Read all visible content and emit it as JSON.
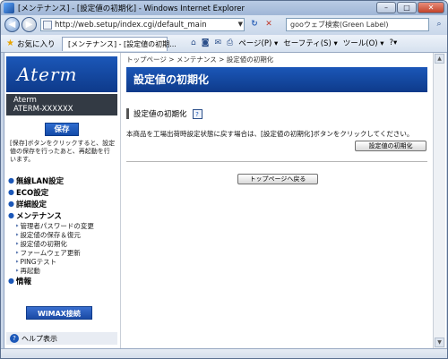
{
  "window": {
    "title": "[メンテナンス] - [設定値の初期化] - Windows Internet Explorer",
    "min": "–",
    "max": "□",
    "close": "✕"
  },
  "address": {
    "url": "http://web.setup/index.cgi/default_main",
    "search_text": "gooウェブ検索(Green Label)"
  },
  "favorites": {
    "label": "お気に入り",
    "tab_title": "[メンテナンス] - [設定値の初期...",
    "menus": [
      "ページ(P) ▾",
      "セーフティ(S) ▾",
      "ツール(O) ▾",
      "?▾"
    ]
  },
  "sidebar": {
    "logo_text": "Aterm",
    "model_line1": "Aterm",
    "model_line2": "ATERM-XXXXXX",
    "save_label": "保存",
    "save_note": "[保存]ボタンをクリックすると、設定値の保存を行ったあと、再起動を行います。",
    "menu": [
      {
        "label": "無線LAN設定"
      },
      {
        "label": "ECO設定"
      },
      {
        "label": "詳細設定"
      },
      {
        "label": "メンテナンス"
      }
    ],
    "submenu": [
      "管理者パスワードの変更",
      "設定値の保存＆復元",
      "設定値の初期化",
      "ファームウェア更新",
      "PINGテスト",
      "再起動"
    ],
    "info_label": "情報",
    "wimax_label": "WiMAX接続",
    "help_label": "ヘルプ表示"
  },
  "main": {
    "breadcrumb": "トップページ > メンテナンス > 設定値の初期化",
    "page_title": "設定値の初期化",
    "section_title": "設定値の初期化",
    "description": "本商品を工場出荷時設定状態に戻す場合は、[設定値の初期化]ボタンをクリックしてください。",
    "init_button": "設定値の初期化",
    "top_button": "トップページへ戻る"
  }
}
